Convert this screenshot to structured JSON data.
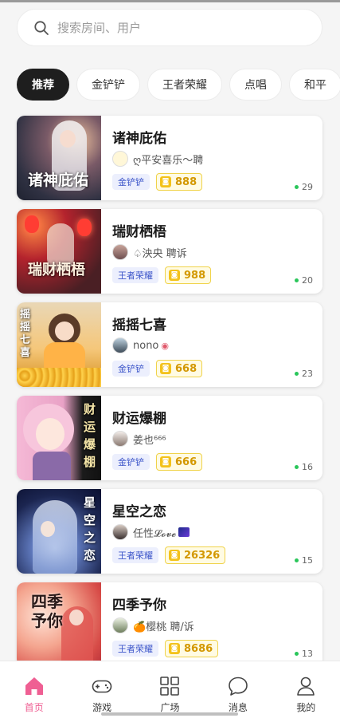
{
  "search": {
    "placeholder": "搜索房间、用户"
  },
  "tabs": [
    {
      "label": "推荐",
      "active": true
    },
    {
      "label": "金铲铲"
    },
    {
      "label": "王者荣耀"
    },
    {
      "label": "点唱"
    },
    {
      "label": "和平"
    }
  ],
  "rooms": [
    {
      "cover_text": "诸神庇佑",
      "title": "诸神庇佑",
      "host_name": "ღ平安喜乐～聘",
      "game": "金铲铲",
      "coins": "888",
      "online": "29"
    },
    {
      "cover_text": "瑞财栖梧",
      "title": "瑞财栖梧",
      "host_name": "♤泱央 聘诉",
      "game": "王者荣耀",
      "coins": "988",
      "online": "20"
    },
    {
      "cover_text": "摇摇七喜",
      "title": "摇摇七喜",
      "host_name": "nono",
      "game": "金铲铲",
      "coins": "668",
      "online": "23"
    },
    {
      "cover_text": "财运爆棚",
      "title": "财运爆棚",
      "host_name": "姜也⁶⁶⁶",
      "game": "金铲铲",
      "coins": "666",
      "online": "16"
    },
    {
      "cover_text": "星空之恋",
      "title": "星空之恋",
      "host_name": "任性𝓛𝓸𝓿𝓮",
      "game": "王者荣耀",
      "coins": "26326",
      "online": "15"
    },
    {
      "cover_text": "四季予你",
      "title": "四季予你",
      "host_name": "🍊樱桃 聘/诉",
      "game": "王者荣耀",
      "coins": "8686",
      "online": "13"
    }
  ],
  "coin_symbol": "◙",
  "nav": [
    {
      "label": "首页",
      "icon": "home-icon",
      "active": true
    },
    {
      "label": "游戏",
      "icon": "gamepad-icon"
    },
    {
      "label": "广场",
      "icon": "grid-icon"
    },
    {
      "label": "消息",
      "icon": "message-icon"
    },
    {
      "label": "我的",
      "icon": "profile-icon"
    }
  ],
  "colors": {
    "accent": "#ef5f93",
    "tab_active_bg": "#1e1e1e",
    "game_tag_text": "#3c55c9",
    "coin_text": "#d39800",
    "online_dot": "#2ac65a"
  }
}
